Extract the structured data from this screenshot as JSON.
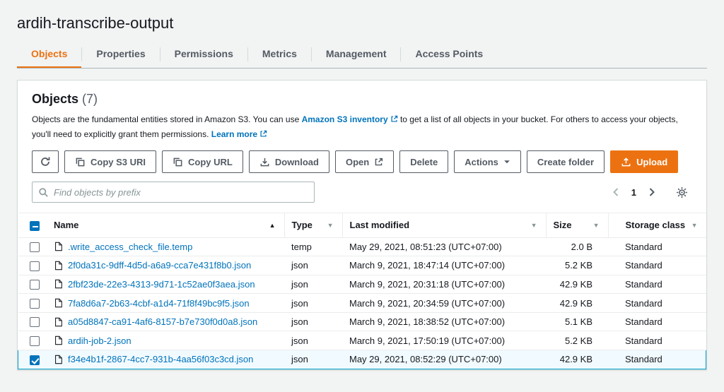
{
  "page": {
    "title": "ardih-transcribe-output"
  },
  "tabs": [
    {
      "label": "Objects"
    },
    {
      "label": "Properties"
    },
    {
      "label": "Permissions"
    },
    {
      "label": "Metrics"
    },
    {
      "label": "Management"
    },
    {
      "label": "Access Points"
    }
  ],
  "panel": {
    "heading": "Objects",
    "count": "(7)",
    "description": {
      "part1": "Objects are the fundamental entities stored in Amazon S3. You can use",
      "inventory_link": "Amazon S3 inventory",
      "part2": "to get a list of all objects in your bucket. For others to access your objects, you'll need to explicitly grant them permissions.",
      "learn_more_link": "Learn more"
    },
    "toolbar": {
      "copy_s3_uri": "Copy S3 URI",
      "copy_url": "Copy URL",
      "download": "Download",
      "open": "Open",
      "delete": "Delete",
      "actions": "Actions",
      "create_folder": "Create folder",
      "upload": "Upload"
    },
    "search": {
      "placeholder": "Find objects by prefix"
    },
    "pagination": {
      "current_page": "1"
    }
  },
  "table": {
    "columns": {
      "name": "Name",
      "type": "Type",
      "last_modified": "Last modified",
      "size": "Size",
      "storage_class": "Storage class"
    },
    "rows": [
      {
        "name": ".write_access_check_file.temp",
        "type": "temp",
        "last_modified": "May 29, 2021, 08:51:23 (UTC+07:00)",
        "size": "2.0 B",
        "storage_class": "Standard",
        "selected": false
      },
      {
        "name": "2f0da31c-9dff-4d5d-a6a9-cca7e431f8b0.json",
        "type": "json",
        "last_modified": "March 9, 2021, 18:47:14 (UTC+07:00)",
        "size": "5.2 KB",
        "storage_class": "Standard",
        "selected": false
      },
      {
        "name": "2fbf23de-22e3-4313-9d71-1c52ae0f3aea.json",
        "type": "json",
        "last_modified": "March 9, 2021, 20:31:18 (UTC+07:00)",
        "size": "42.9 KB",
        "storage_class": "Standard",
        "selected": false
      },
      {
        "name": "7fa8d6a7-2b63-4cbf-a1d4-71f8f49bc9f5.json",
        "type": "json",
        "last_modified": "March 9, 2021, 20:34:59 (UTC+07:00)",
        "size": "42.9 KB",
        "storage_class": "Standard",
        "selected": false
      },
      {
        "name": "a05d8847-ca91-4af6-8157-b7e730f0d0a8.json",
        "type": "json",
        "last_modified": "March 9, 2021, 18:38:52 (UTC+07:00)",
        "size": "5.1 KB",
        "storage_class": "Standard",
        "selected": false
      },
      {
        "name": "ardih-job-2.json",
        "type": "json",
        "last_modified": "March 9, 2021, 17:50:19 (UTC+07:00)",
        "size": "5.2 KB",
        "storage_class": "Standard",
        "selected": false
      },
      {
        "name": "f34e4b1f-2867-4cc7-931b-4aa56f03c3cd.json",
        "type": "json",
        "last_modified": "May 29, 2021, 08:52:29 (UTC+07:00)",
        "size": "42.9 KB",
        "storage_class": "Standard",
        "selected": true
      }
    ]
  },
  "colors": {
    "accent_orange": "#ec7211",
    "link_blue": "#0073bb",
    "selected_row_bg": "#f1faff",
    "selected_row_border": "#00a1c9"
  }
}
